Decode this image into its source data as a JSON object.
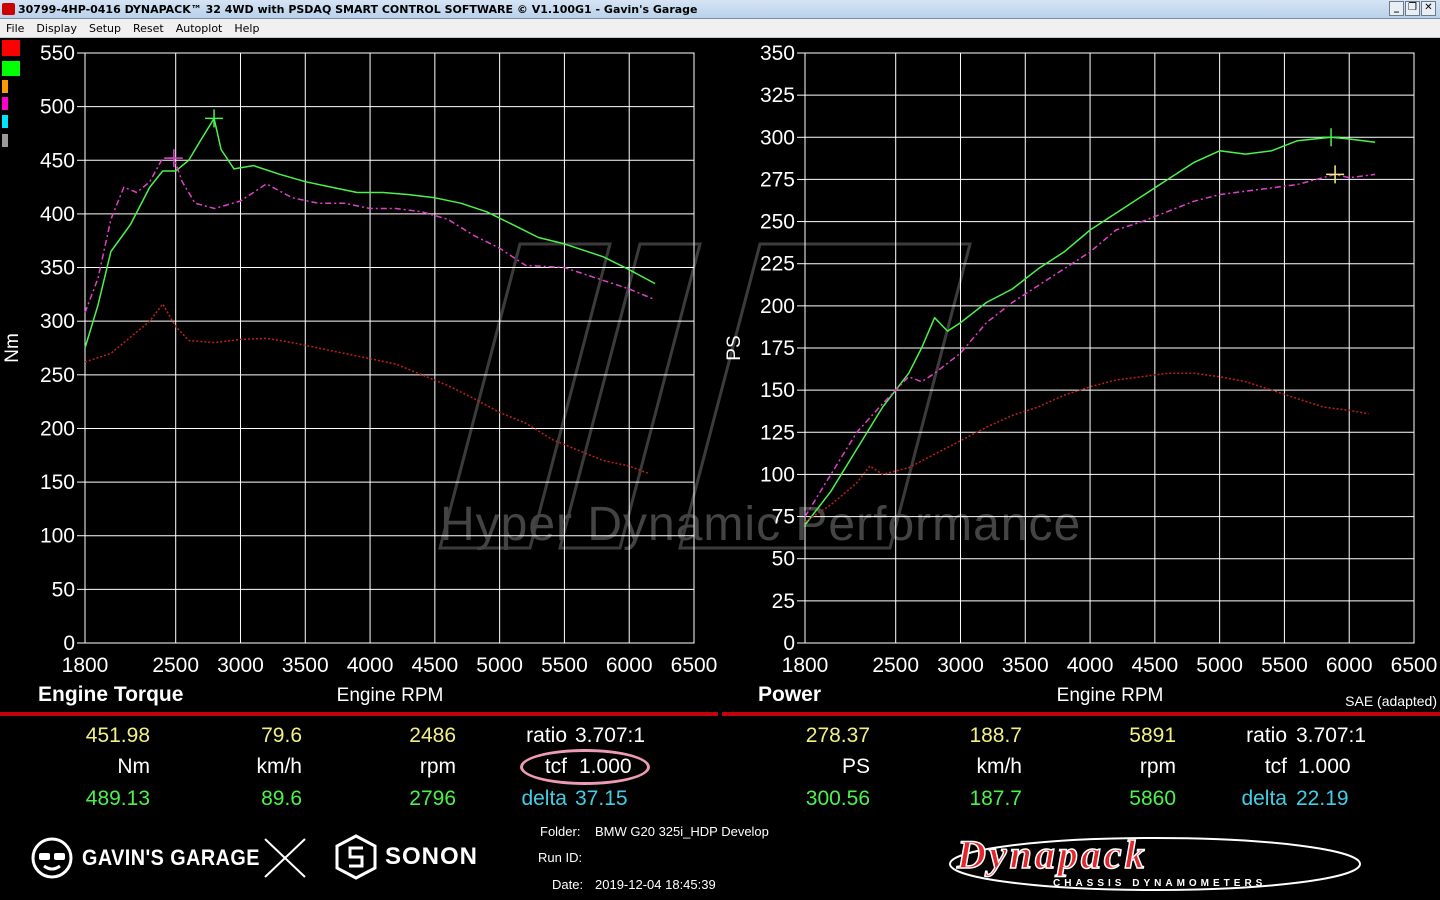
{
  "window": {
    "title": "30799-4HP-0416 DYNAPACK™ 32 4WD with PSDAQ SMART CONTROL SOFTWARE © V1.100G1 - Gavin's Garage",
    "minimize": "_",
    "restore": "❐",
    "close": "✕"
  },
  "menu": [
    "File",
    "Display",
    "Setup",
    "Reset",
    "Autoplot",
    "Help"
  ],
  "colors": {
    "background": "#000000",
    "grid": "#ffffff",
    "run1": "#4cf24c",
    "run2": "#e040c8",
    "run3": "#c0201c",
    "readout_primary": "#f3f082",
    "readout_secondary": "#4cf24c",
    "delta": "#3fd0e8",
    "divider": "#c0000a",
    "highlight": "#ef9bb6"
  },
  "swatches": [
    "#ff0000",
    "#00ff00",
    "#ff9900",
    "#ff00cc",
    "#00e5ff",
    "#999999"
  ],
  "watermark": "Hyper Dynamic Performance",
  "chart_data": [
    {
      "type": "line",
      "title": "Engine Torque",
      "xlabel": "Engine RPM",
      "ylabel": "Nm",
      "xlim": [
        1800,
        6500
      ],
      "ylim": [
        0,
        550
      ],
      "xticks": [
        1800,
        2500,
        3000,
        3500,
        4000,
        4500,
        5000,
        5500,
        6000,
        6500
      ],
      "yticks": [
        0,
        50,
        100,
        150,
        200,
        250,
        300,
        350,
        400,
        450,
        500,
        550
      ],
      "grid": true,
      "series": [
        {
          "color": "#4cf24c",
          "style": "solid",
          "points": [
            [
              1800,
              275
            ],
            [
              1900,
              315
            ],
            [
              2000,
              365
            ],
            [
              2150,
              390
            ],
            [
              2300,
              425
            ],
            [
              2400,
              440
            ],
            [
              2500,
              440
            ],
            [
              2600,
              450
            ],
            [
              2700,
              470
            ],
            [
              2796,
              489
            ],
            [
              2850,
              460
            ],
            [
              2950,
              442
            ],
            [
              3100,
              445
            ],
            [
              3300,
              437
            ],
            [
              3500,
              430
            ],
            [
              3700,
              425
            ],
            [
              3900,
              420
            ],
            [
              4100,
              420
            ],
            [
              4300,
              418
            ],
            [
              4500,
              415
            ],
            [
              4700,
              410
            ],
            [
              4900,
              402
            ],
            [
              5100,
              390
            ],
            [
              5300,
              378
            ],
            [
              5500,
              372
            ],
            [
              5800,
              360
            ],
            [
              6000,
              348
            ],
            [
              6200,
              335
            ]
          ]
        },
        {
          "color": "#e040c8",
          "style": "dashed",
          "points": [
            [
              1800,
              308
            ],
            [
              1900,
              340
            ],
            [
              2000,
              395
            ],
            [
              2100,
              425
            ],
            [
              2200,
              420
            ],
            [
              2300,
              430
            ],
            [
              2400,
              452
            ],
            [
              2486,
              452
            ],
            [
              2550,
              430
            ],
            [
              2650,
              410
            ],
            [
              2800,
              405
            ],
            [
              3000,
              412
            ],
            [
              3200,
              428
            ],
            [
              3400,
              415
            ],
            [
              3600,
              410
            ],
            [
              3800,
              410
            ],
            [
              4000,
              405
            ],
            [
              4200,
              405
            ],
            [
              4400,
              402
            ],
            [
              4600,
              395
            ],
            [
              4800,
              380
            ],
            [
              5000,
              368
            ],
            [
              5200,
              352
            ],
            [
              5500,
              350
            ],
            [
              5800,
              338
            ],
            [
              6000,
              330
            ],
            [
              6200,
              320
            ]
          ]
        },
        {
          "color": "#c0201c",
          "style": "dotted",
          "points": [
            [
              1800,
              262
            ],
            [
              2000,
              270
            ],
            [
              2200,
              290
            ],
            [
              2300,
              300
            ],
            [
              2400,
              316
            ],
            [
              2500,
              295
            ],
            [
              2600,
              282
            ],
            [
              2800,
              280
            ],
            [
              3000,
              283
            ],
            [
              3200,
              284
            ],
            [
              3400,
              280
            ],
            [
              3600,
              275
            ],
            [
              3800,
              270
            ],
            [
              4000,
              265
            ],
            [
              4200,
              260
            ],
            [
              4400,
              250
            ],
            [
              4600,
              240
            ],
            [
              4800,
              228
            ],
            [
              5000,
              215
            ],
            [
              5200,
              205
            ],
            [
              5400,
              190
            ],
            [
              5600,
              180
            ],
            [
              5800,
              170
            ],
            [
              6000,
              165
            ],
            [
              6150,
              158
            ]
          ]
        }
      ],
      "markers": [
        {
          "x": 2486,
          "y": 452,
          "color": "#e040c8"
        },
        {
          "x": 2796,
          "y": 489,
          "color": "#4cf24c"
        }
      ]
    },
    {
      "type": "line",
      "title": "Power",
      "xlabel": "Engine RPM",
      "ylabel": "PS",
      "note": "SAE (adapted)",
      "xlim": [
        1800,
        6500
      ],
      "ylim": [
        0,
        350
      ],
      "xticks": [
        1800,
        2500,
        3000,
        3500,
        4000,
        4500,
        5000,
        5500,
        6000,
        6500
      ],
      "yticks": [
        0,
        25,
        50,
        75,
        100,
        125,
        150,
        175,
        200,
        225,
        250,
        275,
        300,
        325,
        350
      ],
      "grid": true,
      "series": [
        {
          "color": "#4cf24c",
          "style": "solid",
          "points": [
            [
              1800,
              70
            ],
            [
              2000,
              90
            ],
            [
              2200,
              115
            ],
            [
              2400,
              140
            ],
            [
              2600,
              160
            ],
            [
              2700,
              175
            ],
            [
              2800,
              193
            ],
            [
              2900,
              185
            ],
            [
              3000,
              190
            ],
            [
              3200,
              202
            ],
            [
              3400,
              210
            ],
            [
              3600,
              222
            ],
            [
              3800,
              232
            ],
            [
              4000,
              245
            ],
            [
              4200,
              255
            ],
            [
              4400,
              265
            ],
            [
              4600,
              275
            ],
            [
              4800,
              285
            ],
            [
              5000,
              292
            ],
            [
              5200,
              290
            ],
            [
              5400,
              292
            ],
            [
              5600,
              298
            ],
            [
              5860,
              300
            ],
            [
              6000,
              299
            ],
            [
              6200,
              297
            ]
          ]
        },
        {
          "color": "#e040c8",
          "style": "dashed",
          "points": [
            [
              1800,
              75
            ],
            [
              2000,
              100
            ],
            [
              2200,
              125
            ],
            [
              2400,
              142
            ],
            [
              2600,
              158
            ],
            [
              2700,
              155
            ],
            [
              2800,
              160
            ],
            [
              3000,
              172
            ],
            [
              3200,
              190
            ],
            [
              3400,
              202
            ],
            [
              3600,
              212
            ],
            [
              3800,
              222
            ],
            [
              4000,
              232
            ],
            [
              4200,
              245
            ],
            [
              4400,
              250
            ],
            [
              4600,
              256
            ],
            [
              4800,
              262
            ],
            [
              5000,
              266
            ],
            [
              5200,
              268
            ],
            [
              5400,
              270
            ],
            [
              5600,
              272
            ],
            [
              5891,
              278
            ],
            [
              6000,
              276
            ],
            [
              6200,
              278
            ]
          ]
        },
        {
          "color": "#c0201c",
          "style": "dotted",
          "points": [
            [
              1800,
              72
            ],
            [
              2000,
              82
            ],
            [
              2200,
              95
            ],
            [
              2300,
              105
            ],
            [
              2400,
              100
            ],
            [
              2600,
              104
            ],
            [
              2800,
              112
            ],
            [
              3000,
              120
            ],
            [
              3200,
              128
            ],
            [
              3400,
              135
            ],
            [
              3600,
              140
            ],
            [
              3800,
              147
            ],
            [
              4000,
              152
            ],
            [
              4200,
              156
            ],
            [
              4400,
              158
            ],
            [
              4600,
              160
            ],
            [
              4800,
              160
            ],
            [
              5000,
              158
            ],
            [
              5200,
              155
            ],
            [
              5400,
              150
            ],
            [
              5600,
              145
            ],
            [
              5800,
              140
            ],
            [
              6000,
              138
            ],
            [
              6150,
              136
            ]
          ]
        }
      ],
      "markers": [
        {
          "x": 5860,
          "y": 300,
          "color": "#4cf24c"
        },
        {
          "x": 5891,
          "y": 278,
          "color": "#f3f082"
        }
      ]
    }
  ],
  "readouts": {
    "torque": {
      "val1": "451.98",
      "speed1": "79.6",
      "rpm1": "2486",
      "ratio_label": "ratio",
      "ratio_val": "3.707:1",
      "unit": "Nm",
      "speed_unit": "km/h",
      "rpm_unit": "rpm",
      "tcf_label": "tcf",
      "tcf_val": "1.000",
      "val2": "489.13",
      "speed2": "89.6",
      "rpm2": "2796",
      "delta_label": "delta",
      "delta_val": "37.15"
    },
    "power": {
      "val1": "278.37",
      "speed1": "188.7",
      "rpm1": "5891",
      "ratio_label": "ratio",
      "ratio_val": "3.707:1",
      "unit": "PS",
      "speed_unit": "km/h",
      "rpm_unit": "rpm",
      "tcf_label": "tcf",
      "tcf_val": "1.000",
      "val2": "300.56",
      "speed2": "187.7",
      "rpm2": "5860",
      "delta_label": "delta",
      "delta_val": "22.19"
    }
  },
  "info": {
    "folder_label": "Folder:",
    "folder_val": "BMW G20 325i_HDP Develop",
    "runid_label": "Run ID:",
    "runid_val": "",
    "date_label": "Date:",
    "date_val": "2019-12-04 18:45:39"
  },
  "logos": {
    "gavins": "GAVIN'S GARAGE",
    "sonon": "SONON",
    "dynapack": "Dynapack",
    "dynapack_sub": "CHASSIS DYNAMOMETERS"
  }
}
